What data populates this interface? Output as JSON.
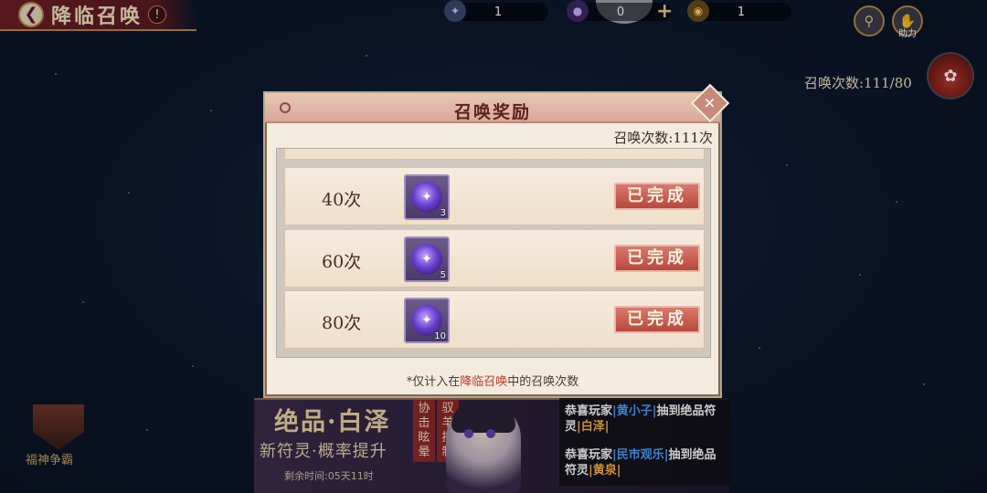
{
  "header": {
    "back_icon": "arrow-left-icon",
    "title": "降临召唤",
    "help_mark": "!"
  },
  "currencies": [
    {
      "icon": "crystal-icon",
      "value": "1"
    },
    {
      "icon": "jade-orb-icon",
      "value": "0"
    },
    {
      "icon": "gold-coin-icon",
      "value": "1"
    }
  ],
  "top_right": {
    "search_icon": "search-icon",
    "assist_icon": "handshake-icon",
    "assist_label": "助力"
  },
  "summon_progress": "召唤次数:111/80",
  "left_badge": {
    "label": "福神争霸"
  },
  "banner": {
    "title": "绝品·白泽",
    "subtitle": "新符灵·概率提升",
    "time_left": "剩余时间:05天11时",
    "tags": [
      "协击眩晕",
      "驭羊控制"
    ]
  },
  "news": [
    {
      "prefix": "恭喜玩家",
      "player": "黄小子",
      "middle": "抽到绝品符灵",
      "item": "白泽"
    },
    {
      "prefix": "恭喜玩家",
      "player": "民市观乐",
      "middle": "抽到绝品符灵",
      "item": "黄泉"
    }
  ],
  "modal": {
    "title": "召唤奖励",
    "summon_count": "召唤次数:111次",
    "rows": [
      {
        "label": "40次",
        "item_icon": "purple-orb-icon",
        "qty": "3",
        "button": "已完成"
      },
      {
        "label": "60次",
        "item_icon": "purple-orb-icon",
        "qty": "5",
        "button": "已完成"
      },
      {
        "label": "80次",
        "item_icon": "purple-orb-icon",
        "qty": "10",
        "button": "已完成"
      }
    ],
    "footnote_before": "*仅计入在",
    "footnote_highlight": "降临召唤",
    "footnote_after": "中的召唤次数"
  }
}
